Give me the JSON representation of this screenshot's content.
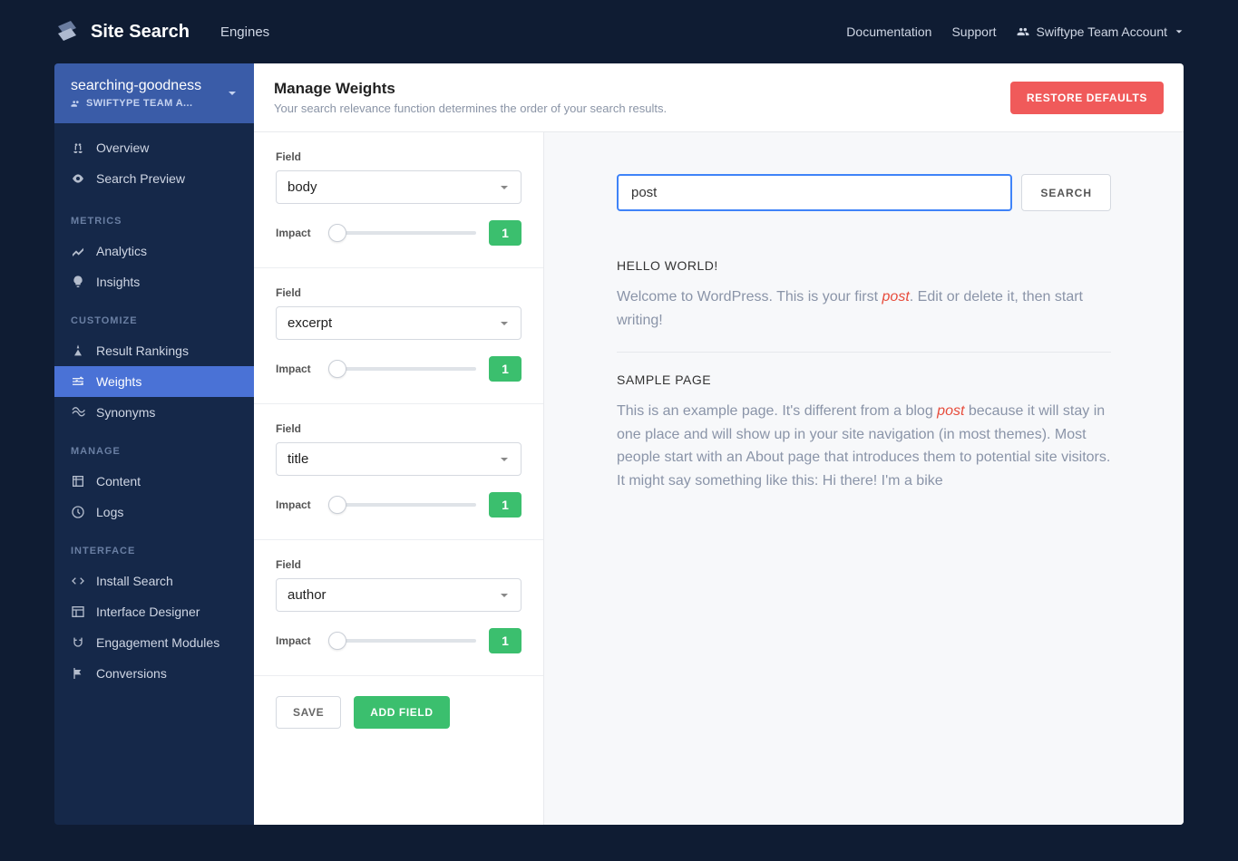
{
  "header": {
    "product": "Site Search",
    "nav": "Engines",
    "docs": "Documentation",
    "support": "Support",
    "account": "Swiftype Team Account"
  },
  "engine": {
    "name": "searching-goodness",
    "team": "SWIFTYPE TEAM A..."
  },
  "sidebar": {
    "overview": "Overview",
    "search_preview": "Search Preview",
    "grp_metrics": "METRICS",
    "analytics": "Analytics",
    "insights": "Insights",
    "grp_customize": "CUSTOMIZE",
    "rankings": "Result Rankings",
    "weights": "Weights",
    "synonyms": "Synonyms",
    "grp_manage": "MANAGE",
    "content": "Content",
    "logs": "Logs",
    "grp_interface": "INTERFACE",
    "install": "Install Search",
    "designer": "Interface Designer",
    "engagement": "Engagement Modules",
    "conversions": "Conversions"
  },
  "page": {
    "title": "Manage Weights",
    "subtitle": "Your search relevance function determines the order of your search results.",
    "restore": "RESTORE DEFAULTS"
  },
  "fields": [
    {
      "label": "Field",
      "value": "body",
      "impact_label": "Impact",
      "impact": "1"
    },
    {
      "label": "Field",
      "value": "excerpt",
      "impact_label": "Impact",
      "impact": "1"
    },
    {
      "label": "Field",
      "value": "title",
      "impact_label": "Impact",
      "impact": "1"
    },
    {
      "label": "Field",
      "value": "author",
      "impact_label": "Impact",
      "impact": "1"
    }
  ],
  "buttons": {
    "save": "SAVE",
    "add": "ADD FIELD",
    "search": "SEARCH"
  },
  "search": {
    "value": "post"
  },
  "results": [
    {
      "title": "HELLO WORLD!",
      "pre": "Welcome to WordPress. This is your first ",
      "hl": "post",
      "post": ". Edit or delete it, then start writing!"
    },
    {
      "title": "SAMPLE PAGE",
      "pre": "This is an example page. It's different from a blog ",
      "hl": "post",
      "post": " because it will stay in one place and will show up in your site navigation (in most themes). Most people start with an About page that introduces them to potential site visitors. It might say something like this: Hi there! I'm a bike"
    }
  ]
}
